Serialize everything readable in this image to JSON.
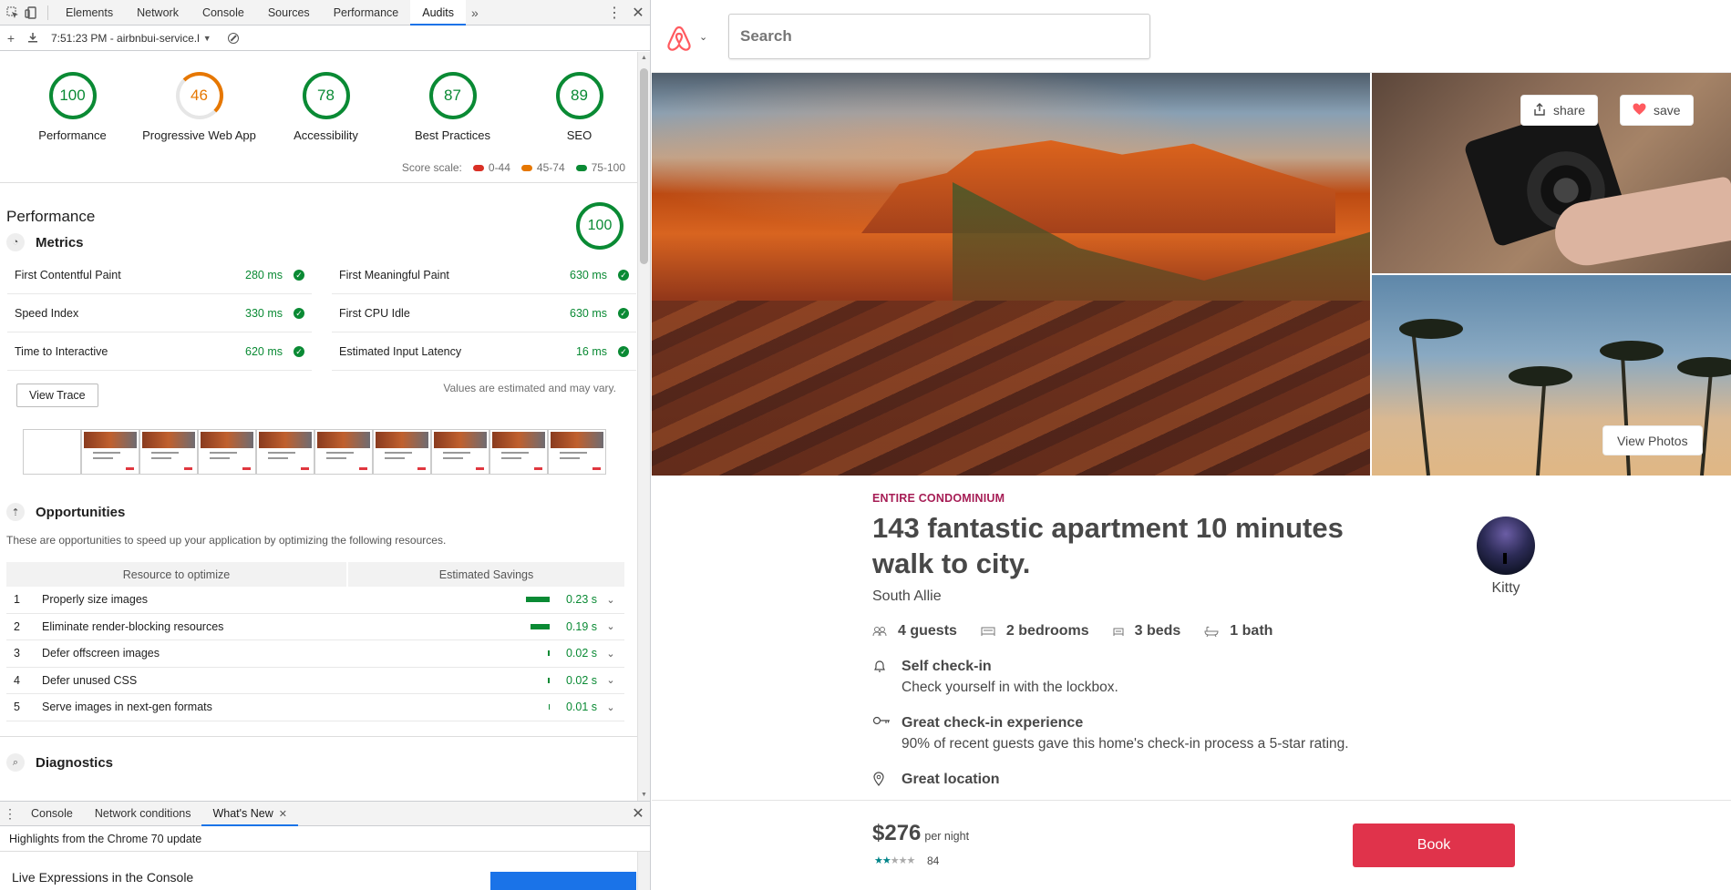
{
  "devtools": {
    "tabs": [
      "Elements",
      "Network",
      "Console",
      "Sources",
      "Performance",
      "Audits"
    ],
    "active_tab": "Audits",
    "report_label": "7:51:23 PM - airbnbui-service.l",
    "categories": [
      {
        "score": "100",
        "label": "Performance"
      },
      {
        "score": "46",
        "label": "Progressive Web App"
      },
      {
        "score": "78",
        "label": "Accessibility"
      },
      {
        "score": "87",
        "label": "Best Practices"
      },
      {
        "score": "89",
        "label": "SEO"
      }
    ],
    "scale": {
      "label": "Score scale:",
      "ranges": [
        "0-44",
        "45-74",
        "75-100"
      ],
      "colors": [
        "#d93025",
        "#e67700",
        "#0a8a34"
      ]
    },
    "performance": {
      "title": "Performance",
      "score": "100",
      "metrics_heading": "Metrics",
      "metrics": [
        {
          "name": "First Contentful Paint",
          "value": "280 ms"
        },
        {
          "name": "First Meaningful Paint",
          "value": "630 ms"
        },
        {
          "name": "Speed Index",
          "value": "330 ms"
        },
        {
          "name": "First CPU Idle",
          "value": "630 ms"
        },
        {
          "name": "Time to Interactive",
          "value": "620 ms"
        },
        {
          "name": "Estimated Input Latency",
          "value": "16 ms"
        }
      ],
      "view_trace": "View Trace",
      "estimated_note": "Values are estimated and may vary."
    },
    "opportunities": {
      "heading": "Opportunities",
      "description": "These are opportunities to speed up your application by optimizing the following resources.",
      "col_resource": "Resource to optimize",
      "col_savings": "Estimated Savings",
      "rows": [
        {
          "n": "1",
          "title": "Properly size images",
          "savings": "0.23 s"
        },
        {
          "n": "2",
          "title": "Eliminate render-blocking resources",
          "savings": "0.19 s"
        },
        {
          "n": "3",
          "title": "Defer offscreen images",
          "savings": "0.02 s"
        },
        {
          "n": "4",
          "title": "Defer unused CSS",
          "savings": "0.02 s"
        },
        {
          "n": "5",
          "title": "Serve images in next-gen formats",
          "savings": "0.01 s"
        }
      ]
    },
    "diagnostics_heading": "Diagnostics",
    "drawer": {
      "tabs": [
        "Console",
        "Network conditions",
        "What's New"
      ],
      "active_tab": "What's New",
      "highlights": "Highlights from the Chrome 70 update",
      "live_expressions": "Live Expressions in the Console"
    }
  },
  "airbnb": {
    "search_placeholder": "Search",
    "share_label": "share",
    "save_label": "save",
    "view_photos": "View Photos",
    "kind": "ENTIRE CONDOMINIUM",
    "title": "143 fantastic apartment 10 minutes walk to city.",
    "city": "South Allie",
    "host_name": "Kitty",
    "amenities": [
      "4 guests",
      "2 bedrooms",
      "3 beds",
      "1 bath"
    ],
    "features": [
      {
        "title": "Self check-in",
        "desc": "Check yourself in with the lockbox."
      },
      {
        "title": "Great check-in experience",
        "desc": "90% of recent guests gave this home's check-in process a 5-star rating."
      },
      {
        "title": "Great location",
        "desc": ""
      }
    ],
    "price": "$276",
    "per_night": "per night",
    "rating_stars": 2,
    "reviews": "84",
    "book": "Book",
    "brand_color": "#ff5a5f"
  }
}
